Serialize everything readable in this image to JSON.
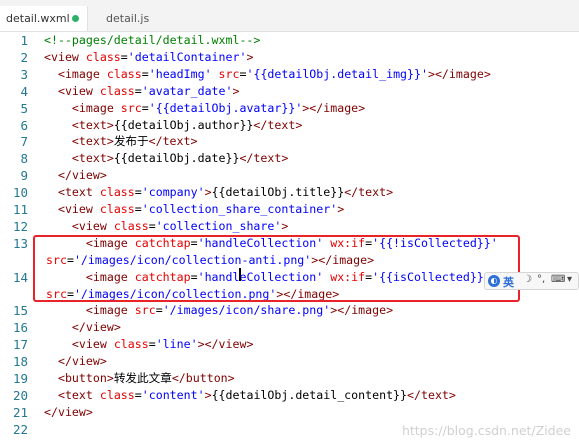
{
  "tabs": [
    {
      "label": "detail.wxml",
      "active": true,
      "modified": true
    },
    {
      "label": "detail.js",
      "active": false,
      "modified": false
    }
  ],
  "colors": {
    "comment": "#008000",
    "tag": "#800000",
    "attribute": "#e50000",
    "string": "#0000ff",
    "line_number": "#237893",
    "highlight_border": "#e8232a"
  },
  "code_lines": [
    {
      "no": "1",
      "wrap": false,
      "tokens": [
        {
          "t": "comment",
          "v": "<!--pages/detail/detail.wxml-->"
        }
      ]
    },
    {
      "no": "2",
      "wrap": false,
      "tokens": [
        {
          "t": "punct",
          "v": "<"
        },
        {
          "t": "tag",
          "v": "view"
        },
        {
          "t": "text",
          "v": " "
        },
        {
          "t": "attr",
          "v": "class"
        },
        {
          "t": "text",
          "v": "="
        },
        {
          "t": "str",
          "v": "'detailContainer'"
        },
        {
          "t": "punct",
          "v": ">"
        }
      ]
    },
    {
      "no": "3",
      "wrap": false,
      "tokens": [
        {
          "t": "text",
          "v": "  "
        },
        {
          "t": "punct",
          "v": "<"
        },
        {
          "t": "tag",
          "v": "image"
        },
        {
          "t": "text",
          "v": " "
        },
        {
          "t": "attr",
          "v": "class"
        },
        {
          "t": "text",
          "v": "="
        },
        {
          "t": "str",
          "v": "'headImg'"
        },
        {
          "t": "text",
          "v": " "
        },
        {
          "t": "attr",
          "v": "src"
        },
        {
          "t": "text",
          "v": "="
        },
        {
          "t": "str",
          "v": "'{{detailObj.detail_img}}'"
        },
        {
          "t": "punct",
          "v": "></"
        },
        {
          "t": "tag",
          "v": "image"
        },
        {
          "t": "punct",
          "v": ">"
        }
      ]
    },
    {
      "no": "4",
      "wrap": false,
      "tokens": [
        {
          "t": "text",
          "v": "  "
        },
        {
          "t": "punct",
          "v": "<"
        },
        {
          "t": "tag",
          "v": "view"
        },
        {
          "t": "text",
          "v": " "
        },
        {
          "t": "attr",
          "v": "class"
        },
        {
          "t": "text",
          "v": "="
        },
        {
          "t": "str",
          "v": "'avatar_date'"
        },
        {
          "t": "punct",
          "v": ">"
        }
      ]
    },
    {
      "no": "5",
      "wrap": false,
      "tokens": [
        {
          "t": "text",
          "v": "    "
        },
        {
          "t": "punct",
          "v": "<"
        },
        {
          "t": "tag",
          "v": "image"
        },
        {
          "t": "text",
          "v": " "
        },
        {
          "t": "attr",
          "v": "src"
        },
        {
          "t": "text",
          "v": "="
        },
        {
          "t": "str",
          "v": "'{{detailObj.avatar}}'"
        },
        {
          "t": "punct",
          "v": "></"
        },
        {
          "t": "tag",
          "v": "image"
        },
        {
          "t": "punct",
          "v": ">"
        }
      ]
    },
    {
      "no": "6",
      "wrap": false,
      "tokens": [
        {
          "t": "text",
          "v": "    "
        },
        {
          "t": "punct",
          "v": "<"
        },
        {
          "t": "tag",
          "v": "text"
        },
        {
          "t": "punct",
          "v": ">"
        },
        {
          "t": "text",
          "v": "{{detailObj.author}}"
        },
        {
          "t": "punct",
          "v": "</"
        },
        {
          "t": "tag",
          "v": "text"
        },
        {
          "t": "punct",
          "v": ">"
        }
      ]
    },
    {
      "no": "7",
      "wrap": false,
      "tokens": [
        {
          "t": "text",
          "v": "    "
        },
        {
          "t": "punct",
          "v": "<"
        },
        {
          "t": "tag",
          "v": "text"
        },
        {
          "t": "punct",
          "v": ">"
        },
        {
          "t": "text",
          "v": "发布于"
        },
        {
          "t": "punct",
          "v": "</"
        },
        {
          "t": "tag",
          "v": "text"
        },
        {
          "t": "punct",
          "v": ">"
        }
      ]
    },
    {
      "no": "8",
      "wrap": false,
      "tokens": [
        {
          "t": "text",
          "v": "    "
        },
        {
          "t": "punct",
          "v": "<"
        },
        {
          "t": "tag",
          "v": "text"
        },
        {
          "t": "punct",
          "v": ">"
        },
        {
          "t": "text",
          "v": "{{detailObj.date}}"
        },
        {
          "t": "punct",
          "v": "</"
        },
        {
          "t": "tag",
          "v": "text"
        },
        {
          "t": "punct",
          "v": ">"
        }
      ]
    },
    {
      "no": "9",
      "wrap": false,
      "tokens": [
        {
          "t": "text",
          "v": "  "
        },
        {
          "t": "punct",
          "v": "</"
        },
        {
          "t": "tag",
          "v": "view"
        },
        {
          "t": "punct",
          "v": ">"
        }
      ]
    },
    {
      "no": "10",
      "wrap": false,
      "tokens": [
        {
          "t": "text",
          "v": "  "
        },
        {
          "t": "punct",
          "v": "<"
        },
        {
          "t": "tag",
          "v": "text"
        },
        {
          "t": "text",
          "v": " "
        },
        {
          "t": "attr",
          "v": "class"
        },
        {
          "t": "text",
          "v": "="
        },
        {
          "t": "str",
          "v": "'company'"
        },
        {
          "t": "punct",
          "v": ">"
        },
        {
          "t": "text",
          "v": "{{detailObj.title}}"
        },
        {
          "t": "punct",
          "v": "</"
        },
        {
          "t": "tag",
          "v": "text"
        },
        {
          "t": "punct",
          "v": ">"
        }
      ]
    },
    {
      "no": "11",
      "wrap": false,
      "tokens": [
        {
          "t": "text",
          "v": "  "
        },
        {
          "t": "punct",
          "v": "<"
        },
        {
          "t": "tag",
          "v": "view"
        },
        {
          "t": "text",
          "v": " "
        },
        {
          "t": "attr",
          "v": "class"
        },
        {
          "t": "text",
          "v": "="
        },
        {
          "t": "str",
          "v": "'collection_share_container'"
        },
        {
          "t": "punct",
          "v": ">"
        }
      ]
    },
    {
      "no": "12",
      "wrap": false,
      "tokens": [
        {
          "t": "text",
          "v": "    "
        },
        {
          "t": "punct",
          "v": "<"
        },
        {
          "t": "tag",
          "v": "view"
        },
        {
          "t": "text",
          "v": " "
        },
        {
          "t": "attr",
          "v": "class"
        },
        {
          "t": "text",
          "v": "="
        },
        {
          "t": "str",
          "v": "'collection_share'"
        },
        {
          "t": "punct",
          "v": ">"
        }
      ]
    },
    {
      "no": "13",
      "wrap": false,
      "tokens": [
        {
          "t": "text",
          "v": "      "
        },
        {
          "t": "punct",
          "v": "<"
        },
        {
          "t": "tag",
          "v": "image"
        },
        {
          "t": "text",
          "v": " "
        },
        {
          "t": "attr",
          "v": "catchtap"
        },
        {
          "t": "text",
          "v": "="
        },
        {
          "t": "str",
          "v": "'handleCollection'"
        },
        {
          "t": "text",
          "v": " "
        },
        {
          "t": "attr",
          "v": "wx:if"
        },
        {
          "t": "text",
          "v": "="
        },
        {
          "t": "str",
          "v": "'{{!isCollected}}'"
        }
      ]
    },
    {
      "no": "",
      "wrap": true,
      "tokens": [
        {
          "t": "attr",
          "v": "src"
        },
        {
          "t": "text",
          "v": "="
        },
        {
          "t": "str",
          "v": "'/images/icon/collection-anti.png'"
        },
        {
          "t": "punct",
          "v": "></"
        },
        {
          "t": "tag",
          "v": "image"
        },
        {
          "t": "punct",
          "v": ">"
        }
      ]
    },
    {
      "no": "14",
      "wrap": false,
      "tokens": [
        {
          "t": "text",
          "v": "      "
        },
        {
          "t": "punct",
          "v": "<"
        },
        {
          "t": "tag",
          "v": "image"
        },
        {
          "t": "text",
          "v": " "
        },
        {
          "t": "attr",
          "v": "catchtap"
        },
        {
          "t": "text",
          "v": "="
        },
        {
          "t": "str",
          "v": "'handleCollection'"
        },
        {
          "t": "text",
          "v": " "
        },
        {
          "t": "attr",
          "v": "wx:if"
        },
        {
          "t": "text",
          "v": "="
        },
        {
          "t": "str",
          "v": "'{{isCollected}}'"
        }
      ]
    },
    {
      "no": "",
      "wrap": true,
      "tokens": [
        {
          "t": "attr",
          "v": "src"
        },
        {
          "t": "text",
          "v": "="
        },
        {
          "t": "str",
          "v": "'/images/icon/collection.png'"
        },
        {
          "t": "punct",
          "v": "></"
        },
        {
          "t": "tag",
          "v": "image"
        },
        {
          "t": "punct",
          "v": ">"
        }
      ]
    },
    {
      "no": "15",
      "wrap": false,
      "tokens": [
        {
          "t": "text",
          "v": "      "
        },
        {
          "t": "punct",
          "v": "<"
        },
        {
          "t": "tag",
          "v": "image"
        },
        {
          "t": "text",
          "v": " "
        },
        {
          "t": "attr",
          "v": "src"
        },
        {
          "t": "text",
          "v": "="
        },
        {
          "t": "str",
          "v": "'/images/icon/share.png'"
        },
        {
          "t": "punct",
          "v": "></"
        },
        {
          "t": "tag",
          "v": "image"
        },
        {
          "t": "punct",
          "v": ">"
        }
      ]
    },
    {
      "no": "16",
      "wrap": false,
      "tokens": [
        {
          "t": "text",
          "v": "    "
        },
        {
          "t": "punct",
          "v": "</"
        },
        {
          "t": "tag",
          "v": "view"
        },
        {
          "t": "punct",
          "v": ">"
        }
      ]
    },
    {
      "no": "17",
      "wrap": false,
      "tokens": [
        {
          "t": "text",
          "v": "    "
        },
        {
          "t": "punct",
          "v": "<"
        },
        {
          "t": "tag",
          "v": "view"
        },
        {
          "t": "text",
          "v": " "
        },
        {
          "t": "attr",
          "v": "class"
        },
        {
          "t": "text",
          "v": "="
        },
        {
          "t": "str",
          "v": "'line'"
        },
        {
          "t": "punct",
          "v": "></"
        },
        {
          "t": "tag",
          "v": "view"
        },
        {
          "t": "punct",
          "v": ">"
        }
      ]
    },
    {
      "no": "18",
      "wrap": false,
      "tokens": [
        {
          "t": "text",
          "v": "  "
        },
        {
          "t": "punct",
          "v": "</"
        },
        {
          "t": "tag",
          "v": "view"
        },
        {
          "t": "punct",
          "v": ">"
        }
      ]
    },
    {
      "no": "19",
      "wrap": false,
      "tokens": [
        {
          "t": "text",
          "v": "  "
        },
        {
          "t": "punct",
          "v": "<"
        },
        {
          "t": "tag",
          "v": "button"
        },
        {
          "t": "punct",
          "v": ">"
        },
        {
          "t": "text",
          "v": "转发此文章"
        },
        {
          "t": "punct",
          "v": "</"
        },
        {
          "t": "tag",
          "v": "button"
        },
        {
          "t": "punct",
          "v": ">"
        }
      ]
    },
    {
      "no": "20",
      "wrap": false,
      "tokens": [
        {
          "t": "text",
          "v": "  "
        },
        {
          "t": "punct",
          "v": "<"
        },
        {
          "t": "tag",
          "v": "text"
        },
        {
          "t": "text",
          "v": " "
        },
        {
          "t": "attr",
          "v": "class"
        },
        {
          "t": "text",
          "v": "="
        },
        {
          "t": "str",
          "v": "'content'"
        },
        {
          "t": "punct",
          "v": ">"
        },
        {
          "t": "text",
          "v": "{{detailObj.detail_content}}"
        },
        {
          "t": "punct",
          "v": "</"
        },
        {
          "t": "tag",
          "v": "text"
        },
        {
          "t": "punct",
          "v": ">"
        }
      ]
    },
    {
      "no": "21",
      "wrap": false,
      "tokens": [
        {
          "t": "punct",
          "v": "</"
        },
        {
          "t": "tag",
          "v": "view"
        },
        {
          "t": "punct",
          "v": ">"
        }
      ]
    },
    {
      "no": "22",
      "wrap": false,
      "tokens": []
    }
  ],
  "ime_toolbar": {
    "language": "英",
    "icons": [
      "moon-icon",
      "comma-icon",
      "keyboard-icon"
    ]
  },
  "watermark": "https://blog.csdn.net/Zidee"
}
